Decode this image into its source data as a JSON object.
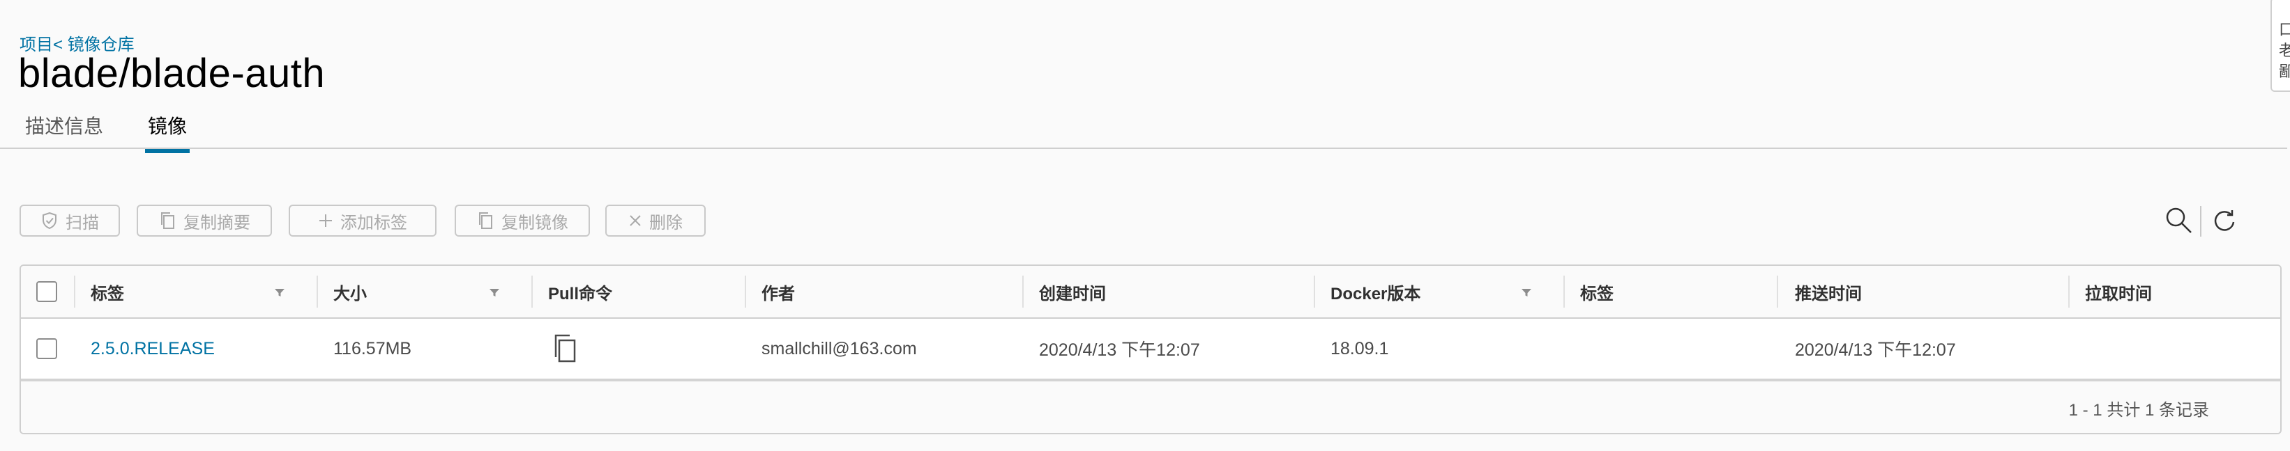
{
  "breadcrumb": {
    "parent": "项目",
    "separator": "<",
    "current": "镜像仓库"
  },
  "title": "blade/blade-auth",
  "tabs": [
    {
      "label": "描述信息",
      "active": false
    },
    {
      "label": "镜像",
      "active": true
    }
  ],
  "toolbar": {
    "scan": "扫描",
    "copy_digest": "复制摘要",
    "add_label": "添加标签",
    "copy_image": "复制镜像",
    "delete": "删除"
  },
  "icons": {
    "search": "search-icon",
    "refresh": "refresh-icon",
    "scan": "shield-check-icon",
    "copy": "copy-icon",
    "add": "plus-icon",
    "delete": "close-icon",
    "filter": "filter-icon"
  },
  "table": {
    "columns": [
      "标签",
      "大小",
      "Pull命令",
      "作者",
      "创建时间",
      "Docker版本",
      "标签",
      "推送时间",
      "拉取时间"
    ],
    "rows": [
      {
        "tag": "2.5.0.RELEASE",
        "size": "116.57MB",
        "pull_command_icon": "copy-icon",
        "author": "smallchill@163.com",
        "created": "2020/4/13 下午12:07",
        "docker_version": "18.09.1",
        "labels": "",
        "pushed": "2020/4/13 下午12:07",
        "pulled": ""
      }
    ],
    "footer": "1 - 1 共计 1 条记录"
  },
  "side_panel": {
    "lines": [
      " ",
      "口",
      "老",
      "鄙"
    ]
  },
  "colors": {
    "accent": "#0072a3",
    "border": "#cfcfcf",
    "disabled_text": "#a9a9a9",
    "background": "#fafafa"
  }
}
